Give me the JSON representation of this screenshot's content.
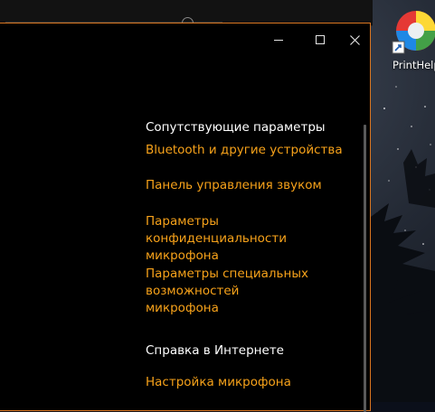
{
  "desktop": {
    "icon": {
      "label": "PrintHelp",
      "icon": "printhelp-app-icon"
    }
  },
  "settings_window": {
    "titlebar": {
      "minimize_icon": "minimize-icon",
      "maximize_icon": "maximize-icon",
      "close_icon": "close-icon"
    },
    "related_settings": {
      "heading": "Сопутствующие параметры",
      "links": [
        "Bluetooth и другие устройства",
        "Панель управления звуком",
        "Параметры конфиденциальности микрофона",
        "Параметры специальных возможностей микрофона"
      ]
    },
    "web_help": {
      "heading": "Справка в Интернете",
      "links": [
        "Настройка микрофона"
      ]
    }
  },
  "colors": {
    "accent": "#f7a21a",
    "window_border": "#d9751f",
    "window_bg": "#000000",
    "heading_text": "#ffffff"
  }
}
